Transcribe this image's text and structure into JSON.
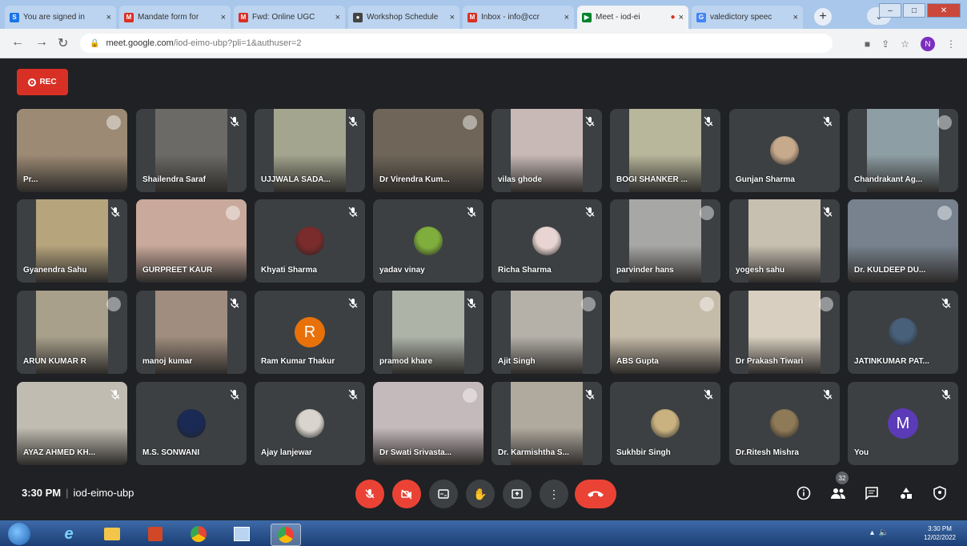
{
  "browser": {
    "tabs": [
      {
        "title": "You are signed in",
        "fav": "S",
        "favcolor": "#1a73e8"
      },
      {
        "title": "Mandate form for",
        "fav": "M",
        "favcolor": "#d93025"
      },
      {
        "title": "Fwd: Online UGC",
        "fav": "M",
        "favcolor": "#d93025"
      },
      {
        "title": "Workshop Schedule",
        "fav": "●",
        "favcolor": "#444"
      },
      {
        "title": "Inbox - info@ccr",
        "fav": "M",
        "favcolor": "#d93025"
      },
      {
        "title": "Meet - iod-ei",
        "fav": "▶",
        "favcolor": "#00832d"
      },
      {
        "title": "valedictory speec",
        "fav": "G",
        "favcolor": "#4285f4"
      }
    ],
    "url_host": "meet.google.com",
    "url_path": "/iod-eimo-ubp?pli=1&authuser=2",
    "profile_initial": "N"
  },
  "meet": {
    "rec_label": "REC",
    "time": "3:30 PM",
    "meeting_code": "iod-eimo-ubp",
    "participant_count": "32",
    "participants": [
      {
        "name": "Pr...",
        "type": "video",
        "bg": "#9c8a74",
        "muted": false
      },
      {
        "name": "Shailendra Saraf",
        "type": "video",
        "bg": "#6b6a66",
        "muted": true
      },
      {
        "name": "UJJWALA SADA...",
        "type": "video",
        "bg": "#a3a58e",
        "muted": true
      },
      {
        "name": "Dr Virendra Kum...",
        "type": "video",
        "bg": "#6f6659",
        "muted": false
      },
      {
        "name": "vilas ghode",
        "type": "video",
        "bg": "#c8b9b6",
        "muted": true
      },
      {
        "name": "BOGI SHANKER ...",
        "type": "video",
        "bg": "#b8b79b",
        "muted": true
      },
      {
        "name": "Gunjan Sharma",
        "type": "pic",
        "bg": "#c7a98c",
        "muted": true
      },
      {
        "name": "Chandrakant Ag...",
        "type": "video",
        "bg": "#8d9ea4",
        "muted": false
      },
      {
        "name": "Gyanendra Sahu",
        "type": "video",
        "bg": "#b6a47d",
        "muted": true
      },
      {
        "name": "GURPREET KAUR",
        "type": "video",
        "bg": "#c9a99b",
        "muted": false
      },
      {
        "name": "Khyati Sharma",
        "type": "pic",
        "bg": "#7a2b2b",
        "muted": true
      },
      {
        "name": "yadav vinay",
        "type": "pic",
        "bg": "#7fae3c",
        "muted": true
      },
      {
        "name": "Richa Sharma",
        "type": "pic",
        "bg": "#e8d5d2",
        "muted": true
      },
      {
        "name": "parvinder hans",
        "type": "video",
        "bg": "#a7a7a6",
        "muted": false
      },
      {
        "name": "yogesh sahu",
        "type": "video",
        "bg": "#c7c0b1",
        "muted": true
      },
      {
        "name": "Dr. KULDEEP DU...",
        "type": "video",
        "bg": "#77828e",
        "muted": false
      },
      {
        "name": "ARUN KUMAR R",
        "type": "video",
        "bg": "#a8a08b",
        "muted": false
      },
      {
        "name": "manoj kumar",
        "type": "video",
        "bg": "#a08d7f",
        "muted": true
      },
      {
        "name": "Ram Kumar Thakur",
        "type": "letter",
        "letter": "R",
        "bg": "#e8710a",
        "muted": true
      },
      {
        "name": "pramod khare",
        "type": "video",
        "bg": "#aeb3a8",
        "muted": true
      },
      {
        "name": "Ajit Singh",
        "type": "video",
        "bg": "#b5b1a9",
        "muted": false
      },
      {
        "name": "ABS Gupta",
        "type": "video",
        "bg": "#c5bba9",
        "muted": false
      },
      {
        "name": "Dr Prakash Tiwari",
        "type": "video",
        "bg": "#d8cfc0",
        "muted": false
      },
      {
        "name": "JATINKUMAR PAT...",
        "type": "pic",
        "bg": "#48607a",
        "muted": true
      },
      {
        "name": "AYAZ AHMED KH...",
        "type": "video",
        "bg": "#c0bcb2",
        "muted": true
      },
      {
        "name": "M.S. SONWANI",
        "type": "pic",
        "bg": "#1a2a55",
        "muted": true
      },
      {
        "name": "Ajay lanjewar",
        "type": "pic",
        "bg": "#d9d4cd",
        "muted": true
      },
      {
        "name": "Dr Swati Srivasta...",
        "type": "video",
        "bg": "#c4b9bb",
        "muted": false
      },
      {
        "name": "Dr. Karmishtha S...",
        "type": "video",
        "bg": "#b0aa9e",
        "muted": true
      },
      {
        "name": "Sukhbir Singh",
        "type": "pic",
        "bg": "#c9b27f",
        "muted": true
      },
      {
        "name": "Dr.Ritesh Mishra",
        "type": "pic",
        "bg": "#8f7a57",
        "muted": true
      },
      {
        "name": "You",
        "type": "letter",
        "letter": "M",
        "bg": "#5b3bb7",
        "muted": true
      }
    ]
  },
  "taskbar": {
    "time": "3:30 PM",
    "date": "12/02/2022"
  },
  "colors": {
    "meet_bg": "#202124",
    "tile_bg": "#3c4043",
    "danger": "#ea4335"
  }
}
